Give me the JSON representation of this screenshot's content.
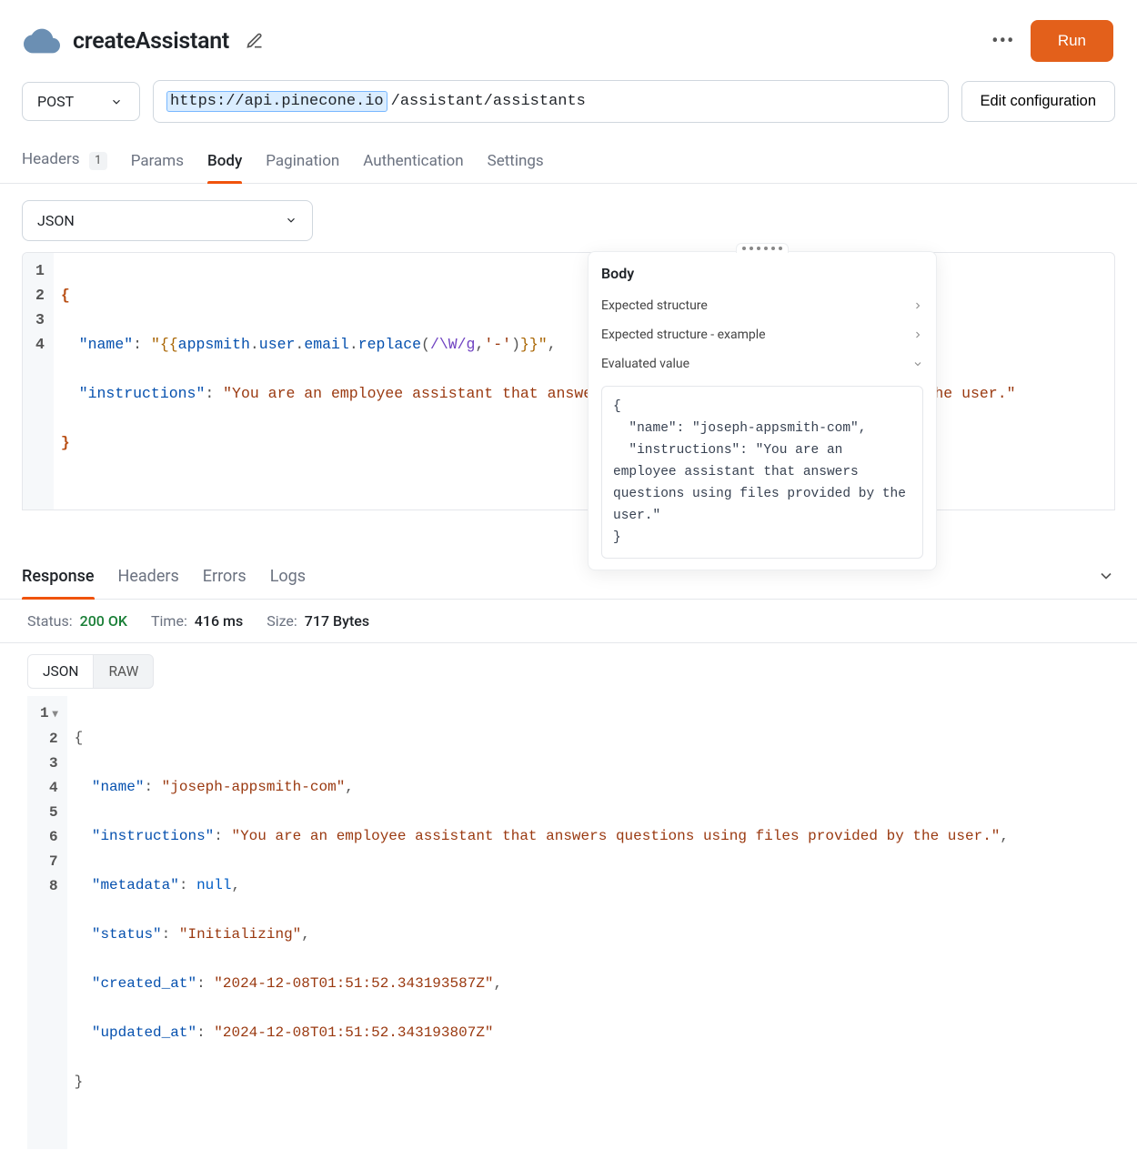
{
  "header": {
    "title": "createAssistant",
    "run_label": "Run"
  },
  "request": {
    "method": "POST",
    "url_base": "https://api.pinecone.io",
    "url_path": "/assistant/assistants",
    "edit_config_label": "Edit configuration"
  },
  "tabs": {
    "headers": "Headers",
    "headers_count": "1",
    "params": "Params",
    "body": "Body",
    "pagination": "Pagination",
    "authentication": "Authentication",
    "settings": "Settings"
  },
  "body_type": "JSON",
  "editor": {
    "lines": [
      "1",
      "2",
      "3",
      "4"
    ],
    "line1_brace": "{",
    "line2_key": "\"name\"",
    "line2_template_open": "\"{{",
    "line2_expr_a": "appsmith",
    "line2_expr_b": "user",
    "line2_expr_c": "email",
    "line2_func": "replace",
    "line2_regex": "/\\W/g",
    "line2_repl": "'-'",
    "line2_template_close": "}}\"",
    "line3_key": "\"instructions\"",
    "line3_value": "\"You are an employee assistant that answers questions using files provided by the user.\"",
    "line4_brace": "}"
  },
  "popover": {
    "title": "Body",
    "expected_struct": "Expected structure",
    "expected_example": "Expected structure - example",
    "evaluated_label": "Evaluated value",
    "evaluated_text": "{\n  \"name\": \"joseph-appsmith-com\",\n  \"instructions\": \"You are an employee assistant that answers questions using files provided by the user.\"\n}"
  },
  "response_tabs": {
    "response": "Response",
    "headers": "Headers",
    "errors": "Errors",
    "logs": "Logs"
  },
  "status": {
    "status_label": "Status:",
    "status_value": "200 OK",
    "time_label": "Time:",
    "time_value": "416 ms",
    "size_label": "Size:",
    "size_value": "717 Bytes"
  },
  "view_tabs": {
    "json": "JSON",
    "raw": "RAW"
  },
  "response_json": {
    "lines": [
      "1",
      "2",
      "3",
      "4",
      "5",
      "6",
      "7",
      "8"
    ],
    "l1": "{",
    "l2_k": "\"name\"",
    "l2_v": "\"joseph-appsmith-com\"",
    "l3_k": "\"instructions\"",
    "l3_v": "\"You are an employee assistant that answers questions using files provided by the user.\"",
    "l4_k": "\"metadata\"",
    "l4_v": "null",
    "l5_k": "\"status\"",
    "l5_v": "\"Initializing\"",
    "l6_k": "\"created_at\"",
    "l6_v": "\"2024-12-08T01:51:52.343193587Z\"",
    "l7_k": "\"updated_at\"",
    "l7_v": "\"2024-12-08T01:51:52.343193807Z\"",
    "l8": "}"
  }
}
